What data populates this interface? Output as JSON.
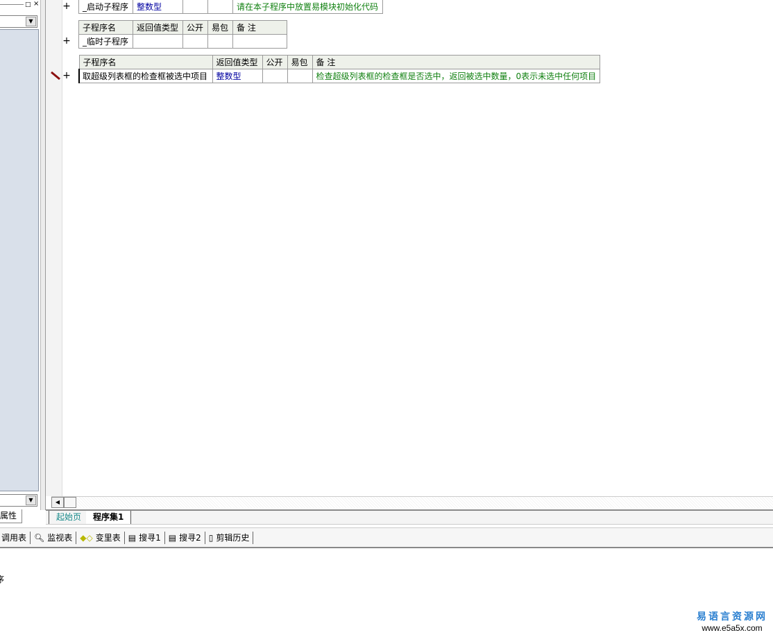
{
  "left_panel": {
    "tab_label": "属性",
    "window_buttons": [
      "□",
      "×"
    ]
  },
  "tables": [
    {
      "header": null,
      "rows": [
        [
          "_启动子程序",
          "整数型",
          "",
          "",
          "请在本子程序中放置易模块初始化代码"
        ]
      ]
    },
    {
      "header": [
        "子程序名",
        "返回值类型",
        "公开",
        "易包",
        "备 注"
      ],
      "rows": [
        [
          "_临时子程序",
          "",
          "",
          "",
          ""
        ]
      ]
    },
    {
      "header": [
        "子程序名",
        "返回值类型",
        "公开",
        "易包",
        "备 注"
      ],
      "rows": [
        [
          "取超级列表框的检查框被选中项目",
          "整数型",
          "",
          "",
          "检查超级列表框的检查框是否选中，返回被选中数量，0表示未选中任何项目"
        ]
      ]
    }
  ],
  "expand_symbol": "+",
  "doc_tabs": [
    {
      "label": "起始页",
      "active": false
    },
    {
      "label": "程序集1",
      "active": true
    }
  ],
  "toolbar": [
    {
      "label": "调用表",
      "icon": "call-table-icon"
    },
    {
      "label": "监视表",
      "icon": "magnifier-icon"
    },
    {
      "label": "变里表",
      "icon": "variable-icon"
    },
    {
      "label": "搜寻1",
      "icon": "search-doc-icon"
    },
    {
      "label": "搜寻2",
      "icon": "search-doc-icon"
    },
    {
      "label": "剪辑历史",
      "icon": "clipboard-icon"
    }
  ],
  "output": {
    "text": "序"
  },
  "watermark": {
    "title": "易语言资源网",
    "url": "www.e5a5x.com"
  },
  "colors": {
    "type": "#0000a0",
    "note": "#108010",
    "header_bg": "#eef1ea",
    "panel": "#d9e0ea"
  }
}
